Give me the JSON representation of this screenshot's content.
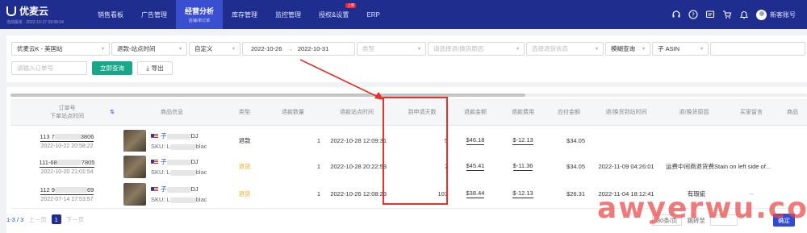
{
  "brand": {
    "name": "优麦云",
    "sub": "当前版本 · 2022-10-27 09:08:34"
  },
  "nav": [
    {
      "label": "销售看板",
      "sub": "",
      "badge": ""
    },
    {
      "label": "广告管理",
      "sub": "",
      "badge": ""
    },
    {
      "label": "经营分析",
      "sub": "店铺/单订单",
      "badge": "",
      "active": true
    },
    {
      "label": "库存管理",
      "sub": "",
      "badge": ""
    },
    {
      "label": "监控管理",
      "sub": "",
      "badge": ""
    },
    {
      "label": "授权&设置",
      "sub": "",
      "badge": "上新"
    },
    {
      "label": "ERP",
      "sub": "",
      "badge": ""
    }
  ],
  "user": {
    "name": "新客账号"
  },
  "filters": {
    "store": "优麦云K - 美国站",
    "time_type": "退款-站点时间",
    "range_type": "自定义",
    "date_start": "2022-10-26",
    "date_sep": "→",
    "date_end": "2022-10-31",
    "type_ph": "类型",
    "reason_ph": "请选择退/换货原因",
    "status_ph": "选择退货状态",
    "fuzzy": "模糊查询",
    "sub_asin": "子 ASIN",
    "order_ph": "请输入订单号",
    "search_btn": "立即查询",
    "export_btn": "导出"
  },
  "columns": {
    "order": "订单号",
    "order_sub": "下单站点时间",
    "product": "商品信息",
    "type": "类型",
    "qty": "退款数量",
    "refund_time": "退款站点时间",
    "days": "到申请天数",
    "refund_amount": "退款金额",
    "refund_fee": "退款费用",
    "paid": "应付金额",
    "return_time": "退/换货到站时间",
    "return_reason": "退/换货原因",
    "buyer_msg": "买家留言",
    "more": "商品"
  },
  "rows": [
    {
      "order_pre": "113 7",
      "order_suf": "3806",
      "order_time": "2022-10-22 20:58:22",
      "prod_pre": "子",
      "prod_suf": "DJ",
      "sku_pre": "SKU: L",
      "sku_suf": "blac",
      "type": "退款",
      "qty": "1",
      "refund_time": "2022-10-28 12:09:31",
      "days": "5",
      "refund_amount": "$46.18",
      "refund_fee": "$-12.13",
      "paid": "$34.05",
      "return_time": "",
      "reason": "",
      "buyer": ""
    },
    {
      "order_pre": "111-68",
      "order_suf": "7805",
      "order_time": "2022-10-20 21:01:54",
      "prod_pre": "子",
      "prod_suf": "DJ",
      "sku_pre": "SKU: L",
      "sku_suf": "blac",
      "type": "退货",
      "qty": "1",
      "refund_time": "2022-10-28 20:22:53",
      "days": "7",
      "refund_amount": "$45.41",
      "refund_fee": "$-11.36",
      "paid": "$34.05",
      "return_time": "2022-11-09 04:26:01",
      "reason": "运费中间商退货费Stain on left side of...",
      "buyer": ""
    },
    {
      "order_pre": "112 9",
      "order_suf": "69",
      "order_time": "2022-07-14 17:53:57",
      "prod_pre": "子",
      "prod_suf": "DJ",
      "sku_pre": "SKU: L",
      "sku_suf": "blac",
      "type": "退货",
      "qty": "1",
      "refund_time": "2022-10-26 12:08:23",
      "days": "103",
      "refund_amount": "$38.44",
      "refund_fee": "$-12.13",
      "paid": "$26.31",
      "return_time": "2022-11-04 18:12:41",
      "reason": "有瑕疵",
      "buyer": "--"
    }
  ],
  "pager": {
    "range": "1-3 / 3",
    "prev": "上一页",
    "page": "1",
    "next": "下一页",
    "per_page": "30条/页",
    "jump": "跳转至",
    "confirm": "确定"
  },
  "watermark": "awyerwu.com",
  "colors": {
    "nav_bg": "#1f2d8f",
    "primary": "#17a889",
    "highlight": "#e0342c",
    "return_type": "#f5a623"
  }
}
